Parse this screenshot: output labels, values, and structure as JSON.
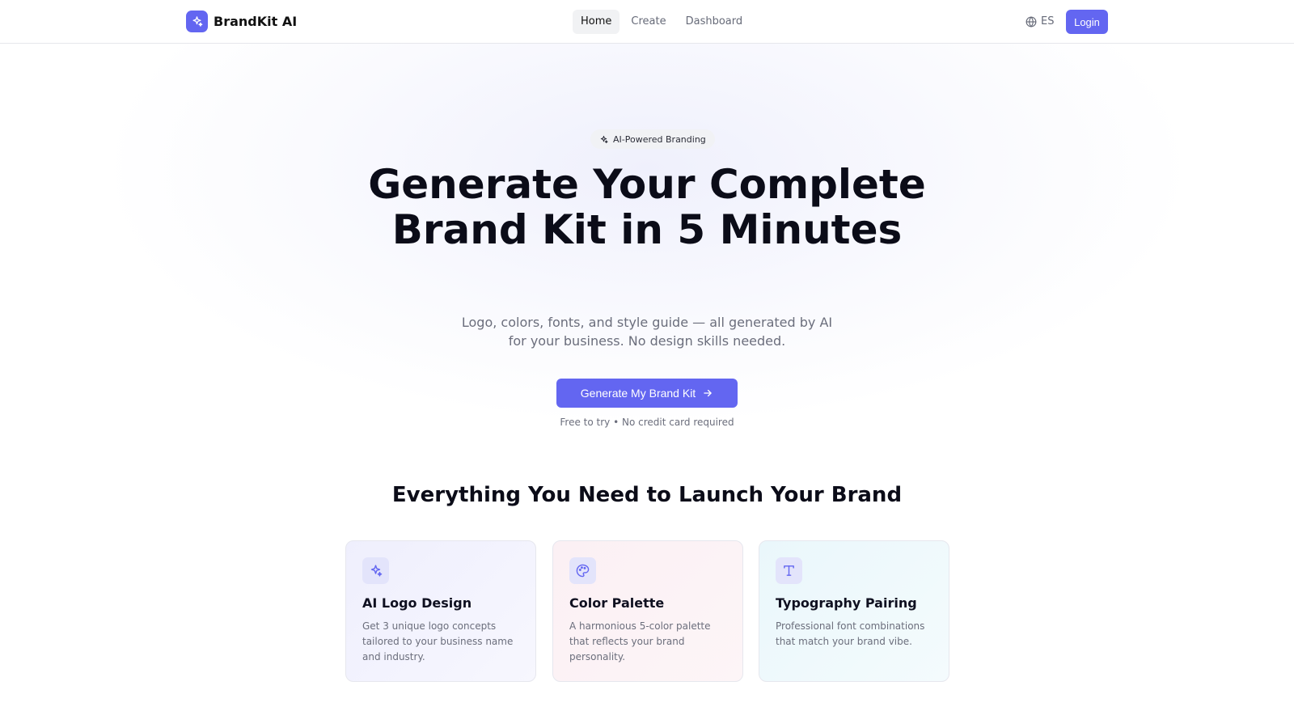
{
  "header": {
    "brand_name": "BrandKit AI",
    "nav": [
      {
        "label": "Home",
        "active": true
      },
      {
        "label": "Create",
        "active": false
      },
      {
        "label": "Dashboard",
        "active": false
      }
    ],
    "language": "ES",
    "login_label": "Login"
  },
  "hero": {
    "badge": "AI-Powered Branding",
    "title": "Generate Your Complete Brand Kit in 5 Minutes",
    "subtitle": "Logo, colors, fonts, and style guide — all generated by AI for your business. No design skills needed.",
    "cta_label": "Generate My Brand Kit",
    "cta_note": "Free to try • No credit card required"
  },
  "features": {
    "title": "Everything You Need to Launch Your Brand",
    "cards": [
      {
        "icon": "sparkles-icon",
        "title": "AI Logo Design",
        "desc": "Get 3 unique logo concepts tailored to your business name and industry."
      },
      {
        "icon": "palette-icon",
        "title": "Color Palette",
        "desc": "A harmonious 5-color palette that reflects your brand personality."
      },
      {
        "icon": "type-icon",
        "title": "Typography Pairing",
        "desc": "Professional font combinations that match your brand vibe."
      }
    ]
  },
  "colors": {
    "accent": "#6366f1",
    "text": "#0b0c18",
    "muted": "#6b6e7c"
  }
}
